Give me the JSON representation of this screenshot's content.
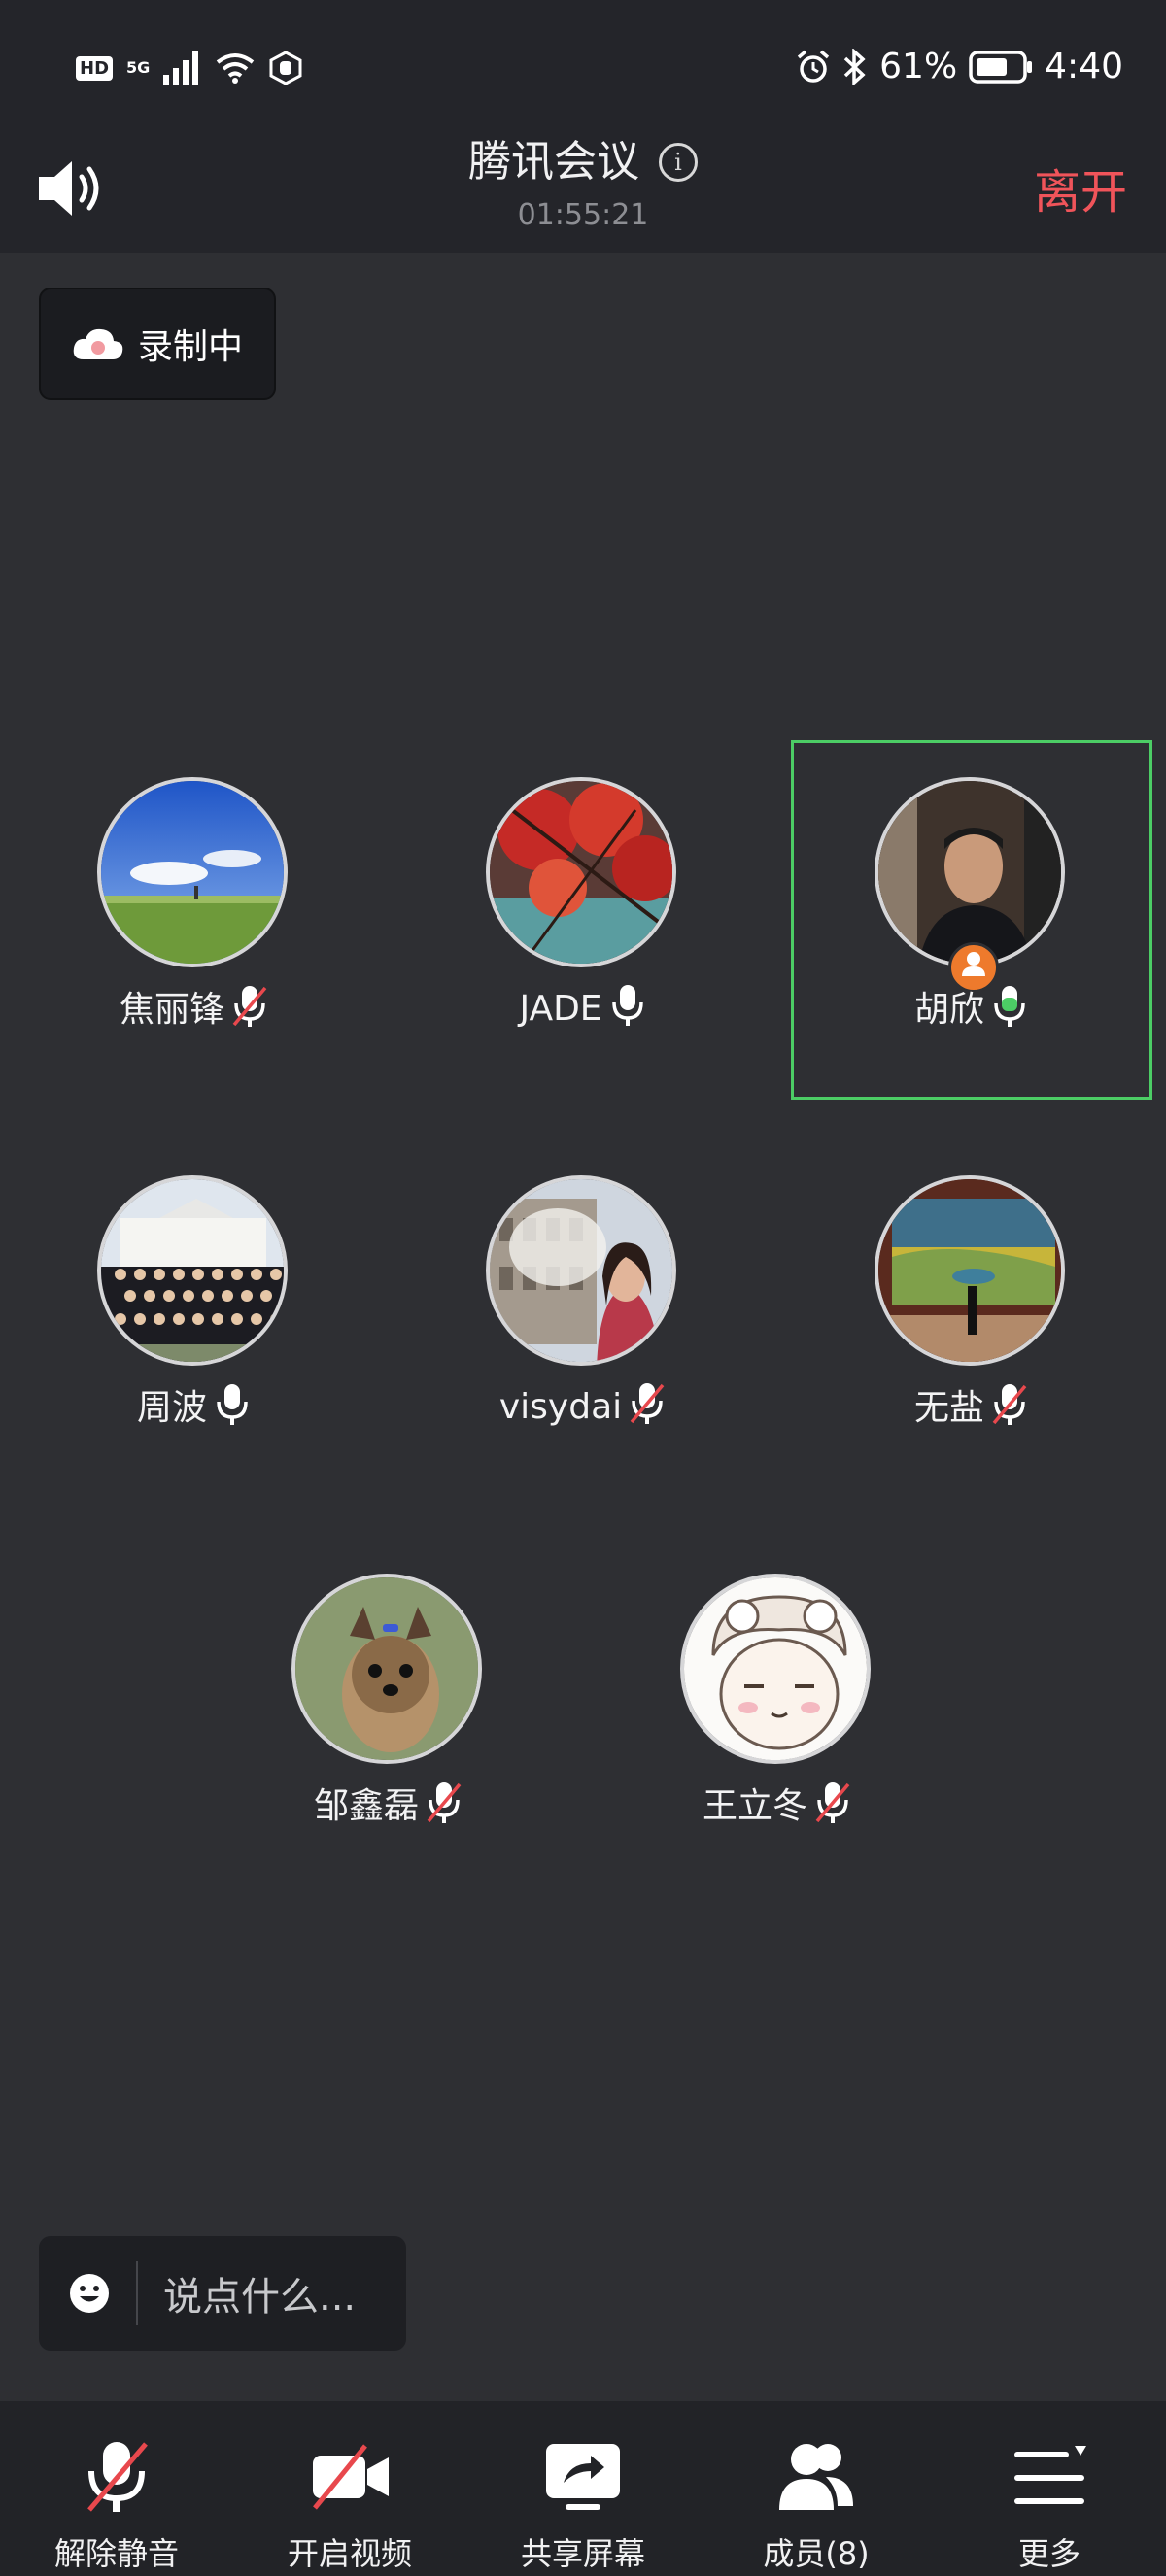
{
  "status_bar": {
    "hd": "HD",
    "network": "5G",
    "battery": "61%",
    "time": "4:40"
  },
  "header": {
    "title": "腾讯会议",
    "timer": "01:55:21",
    "leave_label": "离开"
  },
  "recording_label": "录制中",
  "participants": [
    {
      "name": "焦丽锋",
      "mic": "muted"
    },
    {
      "name": "JADE",
      "mic": "on"
    },
    {
      "name": "胡欣",
      "mic": "speaking",
      "role": "host",
      "active": true
    },
    {
      "name": "周波",
      "mic": "on"
    },
    {
      "name": "visydai",
      "mic": "muted"
    },
    {
      "name": "无盐",
      "mic": "muted"
    },
    {
      "name": "邹鑫磊",
      "mic": "muted"
    },
    {
      "name": "王立冬",
      "mic": "muted"
    }
  ],
  "chat": {
    "placeholder": "说点什么..."
  },
  "toolbar": {
    "unmute_label": "解除静音",
    "video_label": "开启视频",
    "share_label": "共享屏幕",
    "members_label": "成员(8)",
    "more_label": "更多"
  },
  "colors": {
    "leave": "#f0545a",
    "speaking": "#4ccd65",
    "host_badge": "#ee7a2c",
    "muted_slash": "#e8484d"
  }
}
